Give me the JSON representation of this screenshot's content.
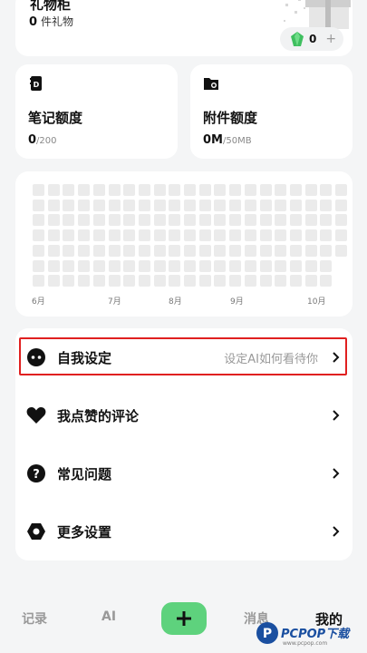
{
  "gift": {
    "title": "礼物柜",
    "count": "0",
    "count_label": "件礼物",
    "gems": "0",
    "gem_plus": "+"
  },
  "quota": {
    "notes": {
      "label": "笔记额度",
      "value": "0",
      "limit": "/200"
    },
    "attachments": {
      "label": "附件额度",
      "value": "0M",
      "limit": "/50MB"
    }
  },
  "heatmap": {
    "months": [
      "6月",
      "7月",
      "8月",
      "9月",
      "10月"
    ],
    "weeks": 21,
    "days": 7,
    "cell_color": "#ebebeb"
  },
  "menu": {
    "items": [
      {
        "label": "自我设定",
        "hint": "设定AI如何看待你",
        "icon": "face-icon"
      },
      {
        "label": "我点赞的评论",
        "hint": "",
        "icon": "heart-icon"
      },
      {
        "label": "常见问题",
        "hint": "",
        "icon": "question-icon"
      },
      {
        "label": "更多设置",
        "hint": "",
        "icon": "gear-icon"
      }
    ]
  },
  "nav": {
    "records": "记录",
    "ai": "AI",
    "add": "+",
    "messages": "消息",
    "mine": "我的"
  },
  "colors": {
    "accent_green": "#5ed27d",
    "highlight_red": "#e02020",
    "background": "#f4f5f6"
  },
  "watermark": {
    "brand": "PCPOP下载",
    "sub": "www.pcpop.com"
  }
}
